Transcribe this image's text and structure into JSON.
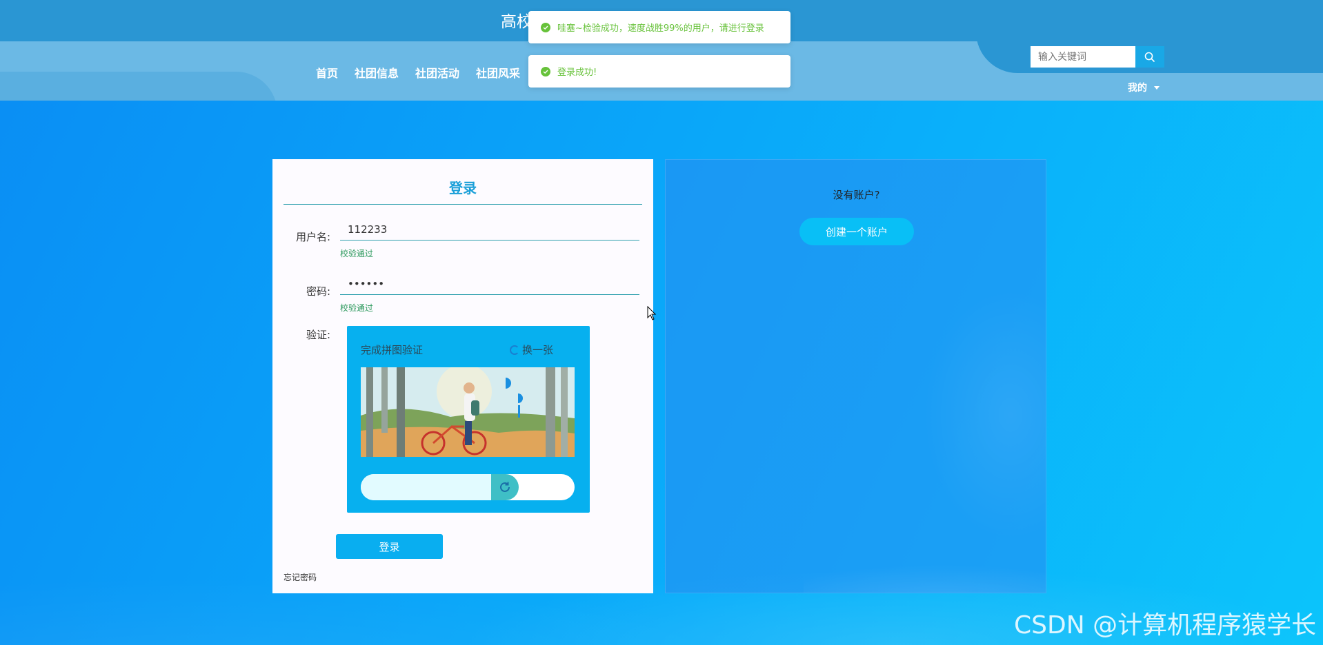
{
  "header": {
    "site_title": "高校",
    "nav": [
      "首页",
      "社团信息",
      "社团活动",
      "社团风采"
    ],
    "search_placeholder": "输入关键词",
    "user_menu_label": "我的"
  },
  "toasts": [
    {
      "text": "哇塞~检验成功，速度战胜99%的用户，请进行登录",
      "type": "success"
    },
    {
      "text": "登录成功!",
      "type": "success"
    }
  ],
  "login": {
    "title": "登录",
    "username_label": "用户名:",
    "username_value": "112233",
    "username_status": "校验通过",
    "password_label": "密码:",
    "password_value": "••••••",
    "password_status": "校验通过",
    "verify_label": "验证:",
    "captcha_title": "完成拼图验证",
    "captcha_refresh": "换一张",
    "slider_progress": 0.7,
    "submit_label": "登录",
    "forgot_label": "忘记密码"
  },
  "register": {
    "question": "没有账户?",
    "button_label": "创建一个账户"
  },
  "watermark": "CSDN @计算机程序猿学长",
  "colors": {
    "accent": "#09aef0",
    "success": "#67c23a",
    "header": "#2a96d3"
  }
}
